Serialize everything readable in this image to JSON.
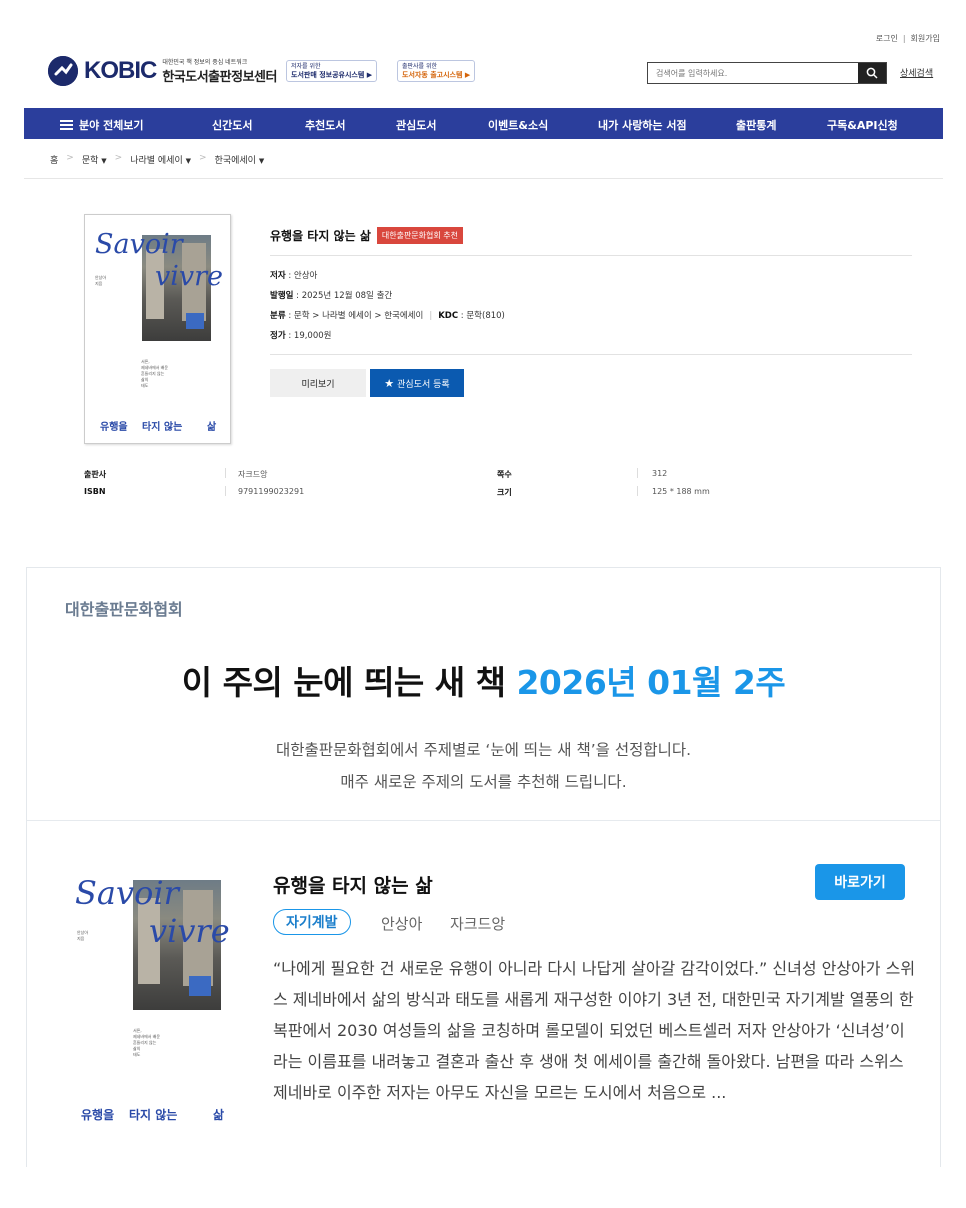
{
  "util": {
    "login": "로그인",
    "signup": "회원가입"
  },
  "logo": {
    "brand": "KOBIC",
    "subtitle": "대한민국 책 정보의 중심 네트워크",
    "name": "한국도서출판정보센터"
  },
  "promos": [
    {
      "small": "저자를 위한",
      "main": "도서판매 정보공유시스템 ▶"
    },
    {
      "small": "출판사를 위한",
      "main": "도서자동 출고시스템 ▶"
    }
  ],
  "search": {
    "placeholder": "검색어를 입력하세요.",
    "advanced": "상세검색",
    "icon": "search-icon"
  },
  "nav": {
    "all": "분야 전체보기",
    "items": [
      "신간도서",
      "추천도서",
      "관심도서",
      "이벤트&소식",
      "내가 사랑하는 서점",
      "출판통계",
      "구독&API신청"
    ]
  },
  "breadcrumb": {
    "home": "홈",
    "c1": "문학",
    "c2": "나라별 에세이",
    "c3": "한국에세이"
  },
  "book": {
    "title": "유행을 타지 않는 삶",
    "badge": "대한출판문화협회 추천",
    "author_label": "저자",
    "author": " : 안상아",
    "date_label": "발행일",
    "date": " : 2025년 12월 08일 출간",
    "category_label": "분류",
    "category": " : 문학 > 나라별 에세이 > 한국에세이",
    "kdc_label": "KDC",
    "kdc": " : 문학(810)",
    "price_label": "정가",
    "price": " : 19,000원",
    "preview_btn": "미리보기",
    "fav_btn": "관심도서 등록",
    "publisher_label": "출판사",
    "publisher": "자크드앙",
    "isbn_label": "ISBN",
    "isbn": "9791199023291",
    "pages_label": "쪽수",
    "pages": "312",
    "size_label": "크기",
    "size": "125 * 188 mm"
  },
  "cover": {
    "word1": "Savoir",
    "word2": "vivre",
    "author_small": "안상아\n지음",
    "blurb": "서른,\n제네바에서 배운\n흔들리지 않는\n삶의\n태도",
    "t1": "유행을",
    "t2": "타지 않는",
    "t3": "삶"
  },
  "feature": {
    "org": "대한출판문화협회",
    "head_black": "이 주의 눈에 띄는 새 책 ",
    "head_blue": "2026년 01월 2주",
    "desc1": "대한출판문화협회에서 주제별로 ‘눈에 띄는 새 책’을 선정합니다.",
    "desc2": "매주 새로운 주제의 도서를 추천해 드립니다.",
    "rec_title": "유행을 타지 않는 삶",
    "go_btn": "바로가기",
    "tag": "자기계발",
    "author": "안상아",
    "publisher": "자크드앙",
    "body": "“나에게 필요한 건 새로운 유행이 아니라 다시 나답게 살아갈 감각이었다.” 신녀성 안상아가 스위스 제네바에서 삶의 방식과 태도를 새롭게 재구성한 이야기 3년 전, 대한민국 자기계발 열풍의 한복판에서 2030 여성들의 삶을 코칭하며 롤모델이 되었던 베스트셀러 저자 안상아가 ‘신녀성’이라는 이름표를 내려놓고 결혼과 출산 후 생애 첫 에세이를 출간해 돌아왔다. 남편을 따라 스위스 제네바로 이주한 저자는 아무도 자신을 모르는 도시에서 처음으로 ..."
  }
}
